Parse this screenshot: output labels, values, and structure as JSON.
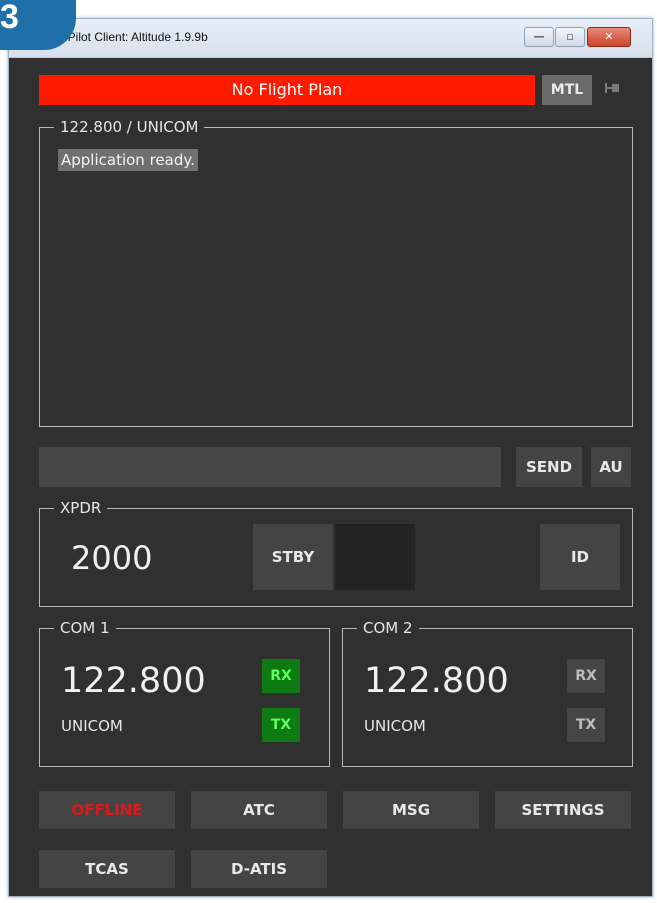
{
  "window": {
    "title": "AO Pilot Client: Altitude 1.9.9b",
    "buttons": {
      "minimize": "—",
      "maximize": "▫",
      "close": "✕"
    }
  },
  "badge": {
    "text": "3"
  },
  "status_bar": {
    "flight_plan": "No Flight Plan",
    "mtl_label": "MTL",
    "pin_icon": "pin-icon"
  },
  "chat": {
    "channel": "122.800 / UNICOM",
    "messages": [
      "Application ready."
    ]
  },
  "input": {
    "value": "",
    "placeholder": "",
    "send_label": "SEND",
    "au_label": "AU"
  },
  "xpdr": {
    "label": "XPDR",
    "code": "2000",
    "stby_label": "STBY",
    "id_label": "ID"
  },
  "com1": {
    "label": "COM 1",
    "frequency": "122.800",
    "station": "UNICOM",
    "rx_label": "RX",
    "tx_label": "TX"
  },
  "com2": {
    "label": "COM 2",
    "frequency": "122.800",
    "station": "UNICOM",
    "rx_label": "RX",
    "tx_label": "TX"
  },
  "nav": {
    "offline_label": "OFFLINE",
    "atc_label": "ATC",
    "msg_label": "MSG",
    "settings_label": "SETTINGS",
    "tcas_label": "TCAS",
    "datis_label": "D-ATIS"
  },
  "colors": {
    "flight_plan_bg": "#ff1a00",
    "offline_text": "#d71a1a",
    "active_rx_tx_bg": "#0d7a12",
    "active_rx_tx_text": "#5cff5c",
    "panel_bg": "#303030"
  }
}
